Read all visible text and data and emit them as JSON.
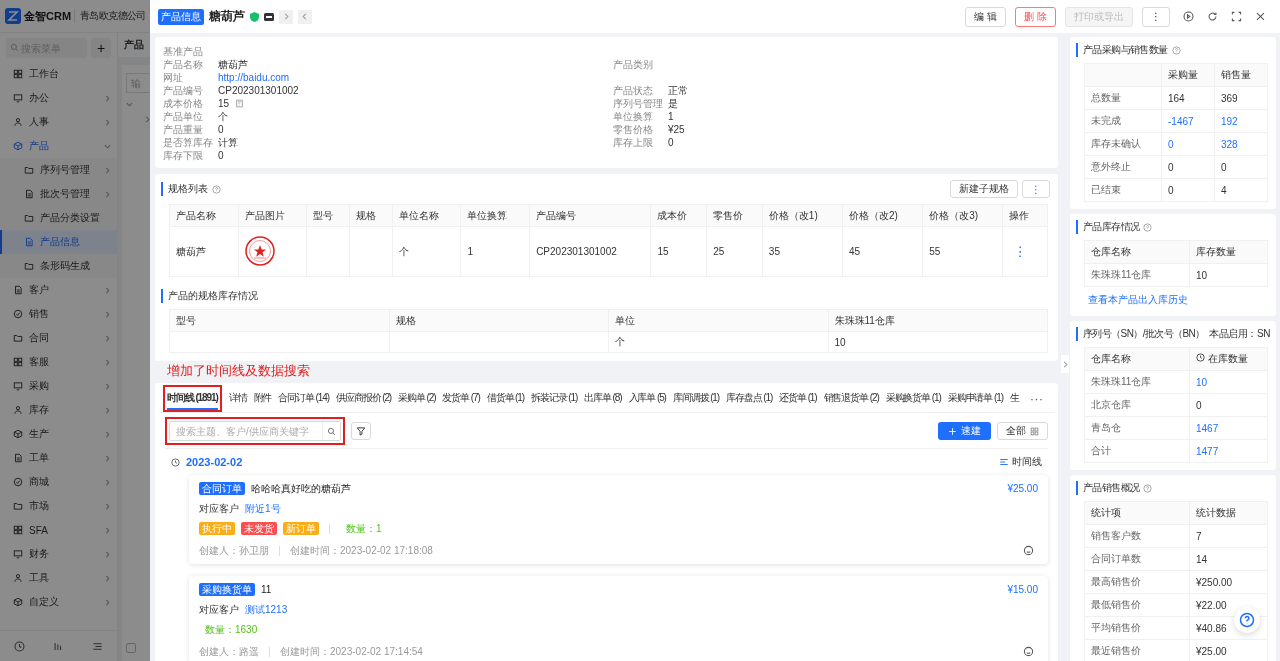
{
  "app": {
    "brand": "金智CRM",
    "company": "青岛欧克德公司",
    "menu_search": {
      "placeholder": "搜索菜单"
    },
    "add_button": "+",
    "menu": [
      {
        "label": "工作台",
        "kind": "link",
        "selected": false
      },
      {
        "label": "办公",
        "kind": "group",
        "selected": false,
        "expanded": false
      },
      {
        "label": "人事",
        "kind": "group",
        "selected": false,
        "expanded": false
      },
      {
        "label": "产品",
        "kind": "group",
        "selected": false,
        "expanded": true,
        "children": [
          {
            "label": "序列号管理",
            "kind": "group",
            "selected": false,
            "expanded": false
          },
          {
            "label": "批次号管理",
            "kind": "group",
            "selected": false,
            "expanded": false
          },
          {
            "label": "产品分类设置",
            "kind": "link",
            "selected": false
          },
          {
            "label": "产品信息",
            "kind": "link",
            "selected": true
          },
          {
            "label": "条形码生成",
            "kind": "link",
            "selected": false
          }
        ]
      },
      {
        "label": "客户",
        "kind": "group",
        "selected": false,
        "expanded": false
      },
      {
        "label": "销售",
        "kind": "group",
        "selected": false,
        "expanded": false
      },
      {
        "label": "合同",
        "kind": "group",
        "selected": false,
        "expanded": false
      },
      {
        "label": "客服",
        "kind": "group",
        "selected": false,
        "expanded": false
      },
      {
        "label": "采购",
        "kind": "group",
        "selected": false,
        "expanded": false
      },
      {
        "label": "库存",
        "kind": "group",
        "selected": false,
        "expanded": false
      },
      {
        "label": "生产",
        "kind": "group",
        "selected": false,
        "expanded": false
      },
      {
        "label": "工单",
        "kind": "group",
        "selected": false,
        "expanded": false
      },
      {
        "label": "商城",
        "kind": "group",
        "selected": false,
        "expanded": false
      },
      {
        "label": "市场",
        "kind": "group",
        "selected": false,
        "expanded": false
      },
      {
        "label": "SFA",
        "kind": "group",
        "selected": false,
        "expanded": false
      },
      {
        "label": "财务",
        "kind": "group",
        "selected": false,
        "expanded": false
      },
      {
        "label": "工具",
        "kind": "group",
        "selected": false,
        "expanded": false
      },
      {
        "label": "自定义",
        "kind": "group",
        "selected": false,
        "expanded": false
      }
    ],
    "page_title": "产品",
    "filter_placeholder": "输",
    "option": {
      "checked": false
    }
  },
  "drawer": {
    "tag": "产品信息",
    "title": "糖葫芦",
    "actions": [
      {
        "label": "编 辑",
        "kind": "default",
        "disabled": false
      },
      {
        "label": "删 除",
        "kind": "danger",
        "disabled": false
      },
      {
        "label": "打印或导出",
        "kind": "default",
        "disabled": true
      },
      {
        "label": "⋮",
        "kind": "default",
        "disabled": false
      }
    ],
    "info": {
      "section_label": "基准产品",
      "rows": [
        {
          "left": {
            "label": "产品名称",
            "value": "糖葫芦",
            "kind": "text"
          },
          "right": {
            "label": "产品类别"
          }
        },
        {
          "left": {
            "label": "网址",
            "value": "http://baidu.com",
            "kind": "link"
          }
        },
        {
          "left": {
            "label": "产品编号",
            "value": "CP202301301002",
            "kind": "text"
          },
          "right": {
            "label": "产品状态",
            "value": "正常",
            "kind": "text"
          }
        },
        {
          "left": {
            "label": "成本价格",
            "value": "15",
            "kind": "calc"
          },
          "right": {
            "label": "序列号管理",
            "value": "是",
            "kind": "text"
          }
        },
        {
          "left": {
            "label": "产品单位",
            "value": "个",
            "kind": "text"
          },
          "right": {
            "label": "单位换算",
            "value": "1",
            "kind": "text"
          }
        },
        {
          "left": {
            "label": "产品重量",
            "value": "0",
            "kind": "text"
          },
          "right": {
            "label": "零售价格",
            "value": "¥25",
            "kind": "text"
          }
        },
        {
          "left": {
            "label": "是否算库存",
            "value": "计算",
            "kind": "text"
          },
          "right": {
            "label": "库存上限",
            "value": "0",
            "kind": "text"
          }
        },
        {
          "left": {
            "label": "库存下限",
            "value": "0",
            "kind": "text"
          }
        }
      ]
    },
    "spec_list": {
      "title": "规格列表",
      "buttons": [
        "新建子规格",
        "⋮"
      ],
      "columns": [
        "产品名称",
        "产品图片",
        "型号",
        "规格",
        "单位名称",
        "单位换算",
        "产品编号",
        "成本价",
        "零售价",
        "价格（改1)",
        "价格（改2)",
        "价格（改3)",
        "操作"
      ],
      "rows": [
        [
          {
            "kind": "text",
            "text": "糖葫芦"
          },
          {
            "kind": "picture"
          },
          {
            "kind": "empty"
          },
          {
            "kind": "empty"
          },
          {
            "kind": "text",
            "text": "个"
          },
          {
            "kind": "text",
            "text": "1"
          },
          {
            "kind": "text",
            "text": "CP202301301002"
          },
          {
            "kind": "text",
            "text": "15"
          },
          {
            "kind": "text",
            "text": "25"
          },
          {
            "kind": "text",
            "text": "35"
          },
          {
            "kind": "text",
            "text": "45"
          },
          {
            "kind": "text",
            "text": "55"
          },
          {
            "kind": "menu",
            "text": "⋮"
          }
        ]
      ]
    },
    "spec_stock": {
      "title": "产品的规格库存情况",
      "columns": [
        "型号",
        "规格",
        "单位",
        "朱珠珠11仓库"
      ],
      "rows": [
        [
          {
            "kind": "empty"
          },
          {
            "kind": "empty"
          },
          {
            "kind": "text",
            "text": "个"
          },
          {
            "kind": "text",
            "text": "10"
          }
        ]
      ]
    },
    "annotation": "增加了时间线及数据搜索",
    "tabs": [
      {
        "label": "时间线 (1891)",
        "selected": true,
        "annotated": true
      },
      {
        "label": "详情",
        "selected": false,
        "annotated": false
      },
      {
        "label": "附件",
        "selected": false,
        "annotated": false
      },
      {
        "label": "合同订单 (14)",
        "selected": false,
        "annotated": false
      },
      {
        "label": "供应商报价 (2)",
        "selected": false,
        "annotated": false
      },
      {
        "label": "采购单 (2)",
        "selected": false,
        "annotated": false
      },
      {
        "label": "发货单 (7)",
        "selected": false,
        "annotated": false
      },
      {
        "label": "借货单 (1)",
        "selected": false,
        "annotated": false
      },
      {
        "label": "拆装记录 (1)",
        "selected": false,
        "annotated": false
      },
      {
        "label": "出库单 (8)",
        "selected": false,
        "annotated": false
      },
      {
        "label": "入库单 (5)",
        "selected": false,
        "annotated": false
      },
      {
        "label": "库间调拨 (1)",
        "selected": false,
        "annotated": false
      },
      {
        "label": "库存盘点 (1)",
        "selected": false,
        "annotated": false
      },
      {
        "label": "还货单 (1)",
        "selected": false,
        "annotated": false
      },
      {
        "label": "销售退货单 (2)",
        "selected": false,
        "annotated": false
      },
      {
        "label": "采购换货单 (1)",
        "selected": false,
        "annotated": false
      },
      {
        "label": "采购申请单 (1)",
        "selected": false,
        "annotated": false
      },
      {
        "label": "生",
        "selected": false,
        "annotated": false
      }
    ],
    "tabs_more": "···",
    "search": {
      "placeholder": "搜索主题、客户/供应商关键字",
      "annotated": true
    },
    "new_button": "速建",
    "scope_button": "全部",
    "timeline": {
      "date": "2023-02-02",
      "view_label": "时间线",
      "entries": [
        {
          "type": "合同订单",
          "title": "哈哈哈真好吃的糖葫芦",
          "amount": "¥25.00",
          "customer_label": "对应客户",
          "customer": "附近1号",
          "status_tags": [
            {
              "label": "执行中",
              "color": "#faad14"
            },
            {
              "label": "未发货",
              "color": "#ff4d4f"
            },
            {
              "label": "新订单",
              "color": "#faad14"
            }
          ],
          "quantity": "数量：1",
          "creator": "创建人：孙卫朋",
          "created": "创建时间：2023-02-02 17:18:08"
        },
        {
          "type": "采购换货单",
          "title": "11",
          "amount": "¥15.00",
          "customer_label": "对应客户",
          "customer": "测试1213",
          "quantity": "数量：1630",
          "creator": "创建人：路遥",
          "created": "创建时间：2023-02-02 17:14:54"
        }
      ]
    },
    "side_cards": [
      {
        "title": "产品采购与销售数量",
        "help": true,
        "columns": [
          {
            "label": "采购量"
          },
          {
            "label": "销售量"
          }
        ],
        "rows": [
          {
            "label": "总数量",
            "cells": [
              {
                "text": "164",
                "link": false
              },
              {
                "text": "369",
                "link": false
              }
            ]
          },
          {
            "label": "未完成",
            "cells": [
              {
                "text": "-1467",
                "link": true
              },
              {
                "text": "192",
                "link": true
              }
            ]
          },
          {
            "label": "库存未确认",
            "cells": [
              {
                "text": "0",
                "link": true
              },
              {
                "text": "328",
                "link": true
              }
            ]
          },
          {
            "label": "意外终止",
            "cells": [
              {
                "text": "0",
                "link": false
              },
              {
                "text": "0",
                "link": false
              }
            ]
          },
          {
            "label": "已结束",
            "cells": [
              {
                "text": "0",
                "link": false
              },
              {
                "text": "4",
                "link": false
              }
            ]
          }
        ]
      },
      {
        "title": "产品库存情况",
        "help": true,
        "row_header": "仓库名称",
        "columns": [
          {
            "label": "库存数量"
          }
        ],
        "rows": [
          {
            "label": "朱珠珠11仓库",
            "cells": [
              {
                "text": "10",
                "link": false
              }
            ]
          }
        ],
        "link": "查看本产品出入库历史"
      },
      {
        "title": "序列号（SN）/批次号（BN）",
        "note": "本品启用：SN",
        "row_header": "仓库名称",
        "columns": [
          {
            "label": "在库数量",
            "icon": true
          }
        ],
        "rows": [
          {
            "label": "朱珠珠11仓库",
            "cells": [
              {
                "text": "10",
                "link": true
              }
            ]
          },
          {
            "label": "北京仓库",
            "cells": [
              {
                "text": "0",
                "link": false
              }
            ]
          },
          {
            "label": "青岛仓",
            "cells": [
              {
                "text": "1467",
                "link": true
              }
            ]
          },
          {
            "label": "合计",
            "cells": [
              {
                "text": "1477",
                "link": true
              }
            ]
          }
        ]
      },
      {
        "title": "产品销售概况",
        "help": true,
        "row_header": "统计项",
        "columns": [
          {
            "label": "统计数据"
          }
        ],
        "rows": [
          {
            "label": "销售客户数",
            "cells": [
              {
                "text": "7",
                "link": false
              }
            ]
          },
          {
            "label": "合同订单数",
            "cells": [
              {
                "text": "14",
                "link": false
              }
            ]
          },
          {
            "label": "最高销售价",
            "cells": [
              {
                "text": "¥250.00",
                "link": false
              }
            ]
          },
          {
            "label": "最低销售价",
            "cells": [
              {
                "text": "¥22.00",
                "link": false
              }
            ]
          },
          {
            "label": "平均销售价",
            "cells": [
              {
                "text": "¥40.86",
                "link": false
              }
            ]
          },
          {
            "label": "最近销售价",
            "cells": [
              {
                "text": "¥25.00",
                "link": false
              }
            ]
          }
        ]
      }
    ]
  }
}
